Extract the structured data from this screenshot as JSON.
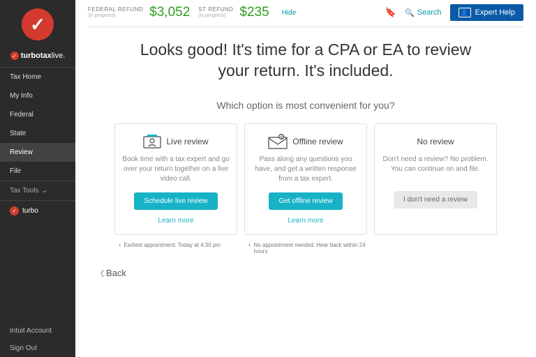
{
  "brand": {
    "name": "turbotax",
    "suffix": "live."
  },
  "sidebar": {
    "items": [
      {
        "label": "Tax Home"
      },
      {
        "label": "My Info"
      },
      {
        "label": "Federal"
      },
      {
        "label": "State"
      },
      {
        "label": "Review"
      },
      {
        "label": "File"
      }
    ],
    "active_index": 4,
    "tools_label": "Tax Tools",
    "turbo_label": "turbo",
    "footer": [
      {
        "label": "Intuit Account"
      },
      {
        "label": "Sign Out"
      }
    ]
  },
  "topbar": {
    "federal": {
      "label": "FEDERAL REFUND",
      "progress": "(in progress)",
      "amount": "$3,052"
    },
    "state": {
      "label": "ST REFUND",
      "progress": "(in progress)",
      "amount": "$235"
    },
    "hide": "Hide",
    "search": "Search",
    "expert": "Expert Help"
  },
  "page": {
    "headline": "Looks good! It's time for a CPA or EA to review your return. It's included.",
    "subhead": "Which option is most convenient for you?",
    "cards": [
      {
        "title": "Live review",
        "desc": "Book time with a tax expert and go over your return together on a live video call.",
        "button": "Schedule live review",
        "learn": "Learn more"
      },
      {
        "title": "Offline review",
        "desc": "Pass along any questions you have, and get a written response from a tax expert.",
        "button": "Get offline review",
        "learn": "Learn more"
      },
      {
        "title": "No review",
        "desc": "Don't need a review? No problem. You can continue on and file.",
        "button": "I don't need a review"
      }
    ],
    "footnotes": [
      "Earliest appointment: Today at 4:30 pm",
      "No appointment needed: Hear back within 24 hours"
    ],
    "back": "Back"
  }
}
